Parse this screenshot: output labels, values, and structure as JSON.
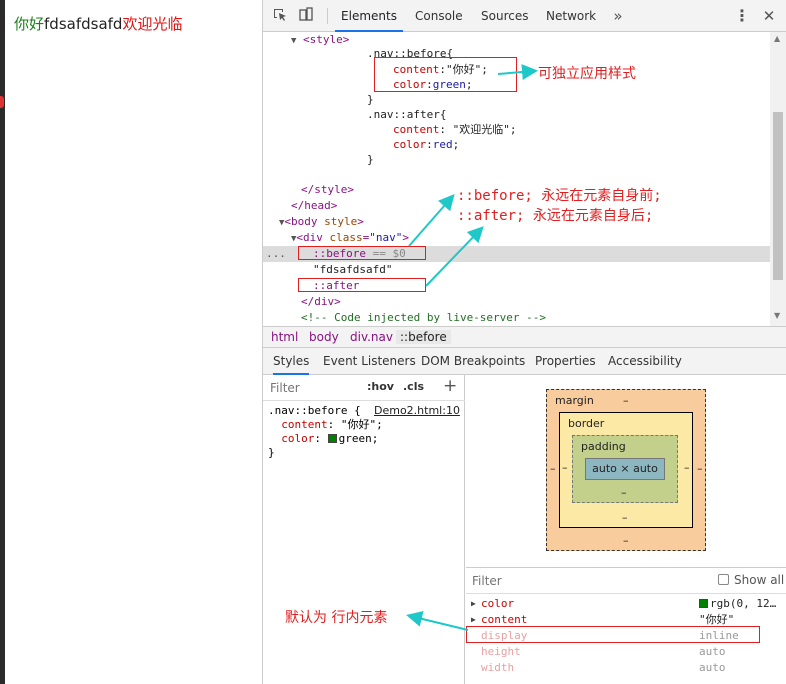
{
  "page": {
    "before_text": "你好",
    "main_text": "fdsafdsafd",
    "after_text": "欢迎光临"
  },
  "toolbar": {
    "tabs": [
      "Elements",
      "Console",
      "Sources",
      "Network"
    ],
    "active_tab": "Elements",
    "more_icon": "chevron-double-right-icon",
    "menu_icon": "kebab-icon",
    "close_icon": "close-icon"
  },
  "elements": {
    "style_open": "<style>",
    "rule1_selector": ".nav::before{",
    "rule1_content_prop": "content",
    "rule1_content_val": "\"你好\"",
    "rule1_color_prop": "color",
    "rule1_color_val": "green",
    "rule_close": "}",
    "rule2_selector": ".nav::after{",
    "rule2_content_prop": "content",
    "rule2_content_val": "\"欢迎光临\"",
    "rule2_color_prop": "color",
    "rule2_color_val": "red",
    "style_close": "</style>",
    "head_close": "</head>",
    "body_tag": "body",
    "body_attr": "style",
    "div_tag": "div",
    "div_attr": "class",
    "div_attr_val": "\"nav\"",
    "before_node": "::before",
    "before_suffix": " == $0",
    "text_node": "\"fdsafdsafd\"",
    "after_node": "::after",
    "div_close": "</div>",
    "comment": "<!-- Code injected by live-server -->",
    "ellipsis": "..."
  },
  "breadcrumb": [
    "html",
    "body",
    "div.nav",
    "::before"
  ],
  "subtabs": [
    "Styles",
    "Event Listeners",
    "DOM Breakpoints",
    "Properties",
    "Accessibility"
  ],
  "styles": {
    "filter_placeholder": "Filter",
    "hov": ":hov",
    "cls": ".cls",
    "plus": "+",
    "rule_selector": ".nav::before {",
    "rule_link": "Demo2.html:10",
    "content_prop": "content",
    "content_val": "\"你好\";",
    "color_prop": "color",
    "color_val": "green;",
    "close": "}",
    "swatch_color": "#008000"
  },
  "boxmodel": {
    "margin_label": "margin",
    "border_label": "border",
    "padding_label": "padding",
    "dash": "–",
    "content": "auto × auto"
  },
  "computed": {
    "filter_placeholder": "Filter",
    "show_all": "Show all",
    "rows": [
      {
        "name": "color",
        "value": "rgb(0, 12…",
        "expandable": true
      },
      {
        "name": "content",
        "value": "\"你好\"",
        "expandable": true
      },
      {
        "name": "display",
        "value": "inline",
        "expandable": false
      },
      {
        "name": "height",
        "value": "auto",
        "expandable": false
      },
      {
        "name": "width",
        "value": "auto",
        "expandable": false
      }
    ]
  },
  "annotations": {
    "style_note": "可独立应用样式",
    "before_note": "::before; 永远在元素自身前;",
    "after_note": "::after; 永远在元素自身后;",
    "inline_note": "默认为 行内元素",
    "color": "#e02020",
    "arrow_color": "#1ec8c8"
  }
}
